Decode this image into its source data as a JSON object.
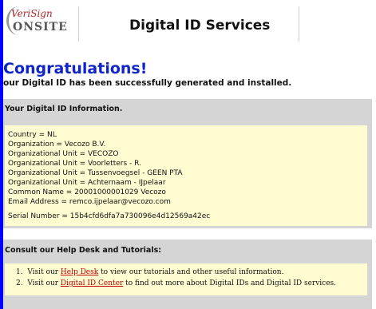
{
  "header": {
    "logo_top": "VeriSign",
    "logo_bottom": "ONSITE",
    "title": "Digital ID Services"
  },
  "main": {
    "heading": "Congratulations!",
    "subtext": "our Digital ID has been successfully generated and installed."
  },
  "info_section": {
    "heading": "Your Digital ID Information.",
    "lines": [
      "Country = NL",
      "Organization = Vecozo B.V.",
      "Organizational Unit = VECOZO",
      "Organizational Unit = Voorletters - R.",
      "Organizational Unit = Tussenvoegsel - GEEN PTA",
      "Organizational Unit = Achternaam - IJpelaar",
      "Common Name = 20001000001029 Vecozo",
      "Email Address = remco.ijpelaar@vecozo.com"
    ],
    "serial": "Serial Number = 15b4cfd6dfa7a730096e4d12569a42ec"
  },
  "help_section": {
    "heading": "Consult our Help Desk and Tutorials:",
    "items": [
      {
        "num": "1.",
        "pre": "Visit our ",
        "link": "Help Desk",
        "post": " to view our tutorials and other useful information."
      },
      {
        "num": "2.",
        "pre": "Visit our ",
        "link": "Digital ID Center",
        "post": " to find out more about Digital IDs and Digital ID services."
      }
    ]
  },
  "colors": {
    "frame": "#0000ff",
    "heading": "#0f25c8",
    "link": "#c00000",
    "infobox": "#fffcd1",
    "section": "#d5d5d5"
  }
}
